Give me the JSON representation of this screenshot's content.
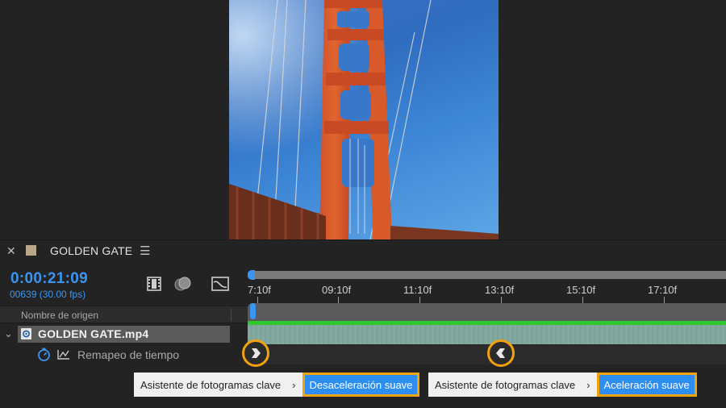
{
  "panel": {
    "title": "GOLDEN GATE",
    "close_icon": "close-icon",
    "menu_icon": "hamburger-menu-icon",
    "swatch_color": "#b9a78a"
  },
  "timecode": {
    "current": "0:00:21:09",
    "frames": "00639 (30.00 fps)",
    "color": "#3b95f0"
  },
  "toolbar_icons": [
    "film-strip-icon",
    "motion-blur-icon",
    "graph-editor-icon"
  ],
  "columns": {
    "source_name": "Nombre de origen"
  },
  "layer": {
    "name": "GOLDEN GATE.mp4",
    "icon": "footage-file-icon"
  },
  "property": {
    "name": "Remapeo de tiempo",
    "stopwatch_icon": "stopwatch-icon",
    "graph_icon": "graph-icon"
  },
  "ruler": {
    "ticks": [
      "7:10f",
      "09:10f",
      "11:10f",
      "13:10f",
      "15:10f",
      "17:10f"
    ]
  },
  "keyframes": [
    {
      "type": "easy-ease-out",
      "icon": "keyframe-ease-out-icon"
    },
    {
      "type": "easy-ease-in",
      "icon": "keyframe-ease-in-icon"
    }
  ],
  "assistants": [
    {
      "menu_label": "Asistente de fotogramas clave",
      "submenu_label": "Desaceleración suave"
    },
    {
      "menu_label": "Asistente de fotogramas clave",
      "submenu_label": "Aceleración suave"
    }
  ],
  "colors": {
    "accent_blue": "#2c8ef0",
    "highlight_orange": "#f2a20c",
    "layer_bar_green": "#2ec82e",
    "layer_bar_teal": "#7ea59c"
  }
}
